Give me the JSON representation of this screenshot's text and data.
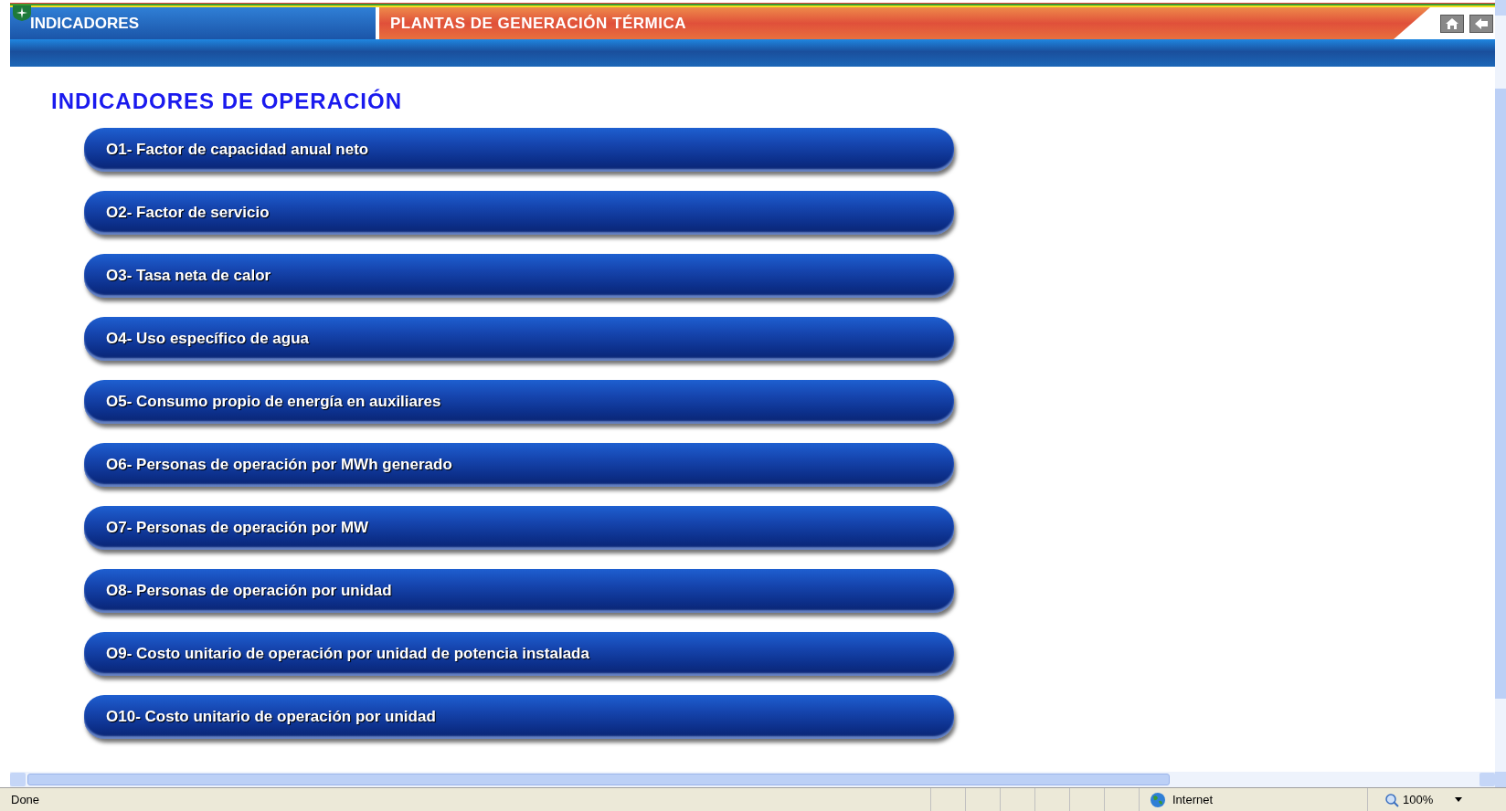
{
  "header": {
    "section": "INDICADORES",
    "title": "PLANTAS DE GENERACIÓN TÉRMICA"
  },
  "page_title": "INDICADORES DE OPERACIÓN",
  "indicators": [
    {
      "label": "O1- Factor de capacidad anual neto"
    },
    {
      "label": "O2- Factor de servicio"
    },
    {
      "label": "O3- Tasa neta de calor"
    },
    {
      "label": "O4- Uso específico de agua"
    },
    {
      "label": "O5- Consumo propio de energía en auxiliares"
    },
    {
      "label": "O6- Personas de operación por MWh generado"
    },
    {
      "label": "O7- Personas de operación por MW"
    },
    {
      "label": "O8- Personas de operación por unidad"
    },
    {
      "label": "O9- Costo unitario de operación por unidad de potencia instalada"
    },
    {
      "label": "O10- Costo unitario de operación por unidad"
    }
  ],
  "status_bar": {
    "status": "Done",
    "zone": "Internet",
    "zoom": "100%"
  }
}
